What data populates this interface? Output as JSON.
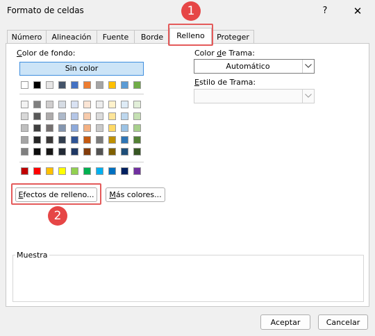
{
  "window": {
    "title": "Formato de celdas",
    "help_glyph": "?",
    "close_glyph": "✕"
  },
  "tabs": [
    {
      "label": "Número",
      "active": false
    },
    {
      "label": "Alineación",
      "active": false
    },
    {
      "label": "Fuente",
      "active": false
    },
    {
      "label": "Borde",
      "active": false
    },
    {
      "label": "Relleno",
      "active": true
    },
    {
      "label": "Proteger",
      "active": false
    }
  ],
  "fill": {
    "background_label_prefix": "",
    "background_label_accel": "C",
    "background_label_rest": "olor de fondo:",
    "no_color_label": "Sin color",
    "swatch_row_theme_base": [
      "#ffffff",
      "#000000",
      "#e7e6e6",
      "#44546a",
      "#4472c4",
      "#ed7d31",
      "#a5a5a5",
      "#ffc000",
      "#5b9bd5",
      "#70ad47"
    ],
    "swatch_rows_shades": [
      [
        "#f2f2f2",
        "#7f7f7f",
        "#d0cece",
        "#d6dce4",
        "#d9e2f3",
        "#fbe5d5",
        "#ededed",
        "#fff2cc",
        "#deebf6",
        "#e2efd9"
      ],
      [
        "#d8d8d8",
        "#595959",
        "#aeabab",
        "#adb9ca",
        "#b4c6e7",
        "#f7cbac",
        "#dbdbdb",
        "#fee599",
        "#bdd7ee",
        "#c5e0b3"
      ],
      [
        "#bfbfbf",
        "#3f3f3f",
        "#757070",
        "#8496b0",
        "#8eaadb",
        "#f4b183",
        "#c9c9c9",
        "#ffd965",
        "#9cc3e5",
        "#a8d08d"
      ],
      [
        "#a5a5a5",
        "#262626",
        "#3a3838",
        "#323f4f",
        "#2f5496",
        "#c55a11",
        "#7b7b7b",
        "#bf9000",
        "#2e75b5",
        "#538135"
      ],
      [
        "#7f7f7f",
        "#0c0c0c",
        "#171616",
        "#222a35",
        "#1f3864",
        "#833c0b",
        "#525252",
        "#7f6000",
        "#1e4e79",
        "#375623"
      ]
    ],
    "swatch_row_standard": [
      "#c00000",
      "#ff0000",
      "#ffc000",
      "#ffff00",
      "#92d050",
      "#00b050",
      "#00b0f0",
      "#0070c0",
      "#002060",
      "#7030a0"
    ],
    "fill_effects_button": {
      "prefix": "",
      "accel": "E",
      "rest": "fectos de relleno..."
    },
    "more_colors_button": {
      "prefix": "",
      "accel": "M",
      "rest": "ás colores..."
    },
    "pattern_color_label": {
      "prefix": "Color ",
      "accel": "d",
      "rest": "e Trama:"
    },
    "pattern_color_value": "Automático",
    "pattern_style_label": {
      "prefix": "",
      "accel": "E",
      "rest": "stilo de Trama:"
    },
    "pattern_style_value": ""
  },
  "sample": {
    "label": "Muestra"
  },
  "annotations": [
    {
      "number": "1",
      "color": "#e64646"
    },
    {
      "number": "2",
      "color": "#e64646"
    }
  ],
  "footer": {
    "ok_label": "Aceptar",
    "cancel_label": "Cancelar"
  }
}
